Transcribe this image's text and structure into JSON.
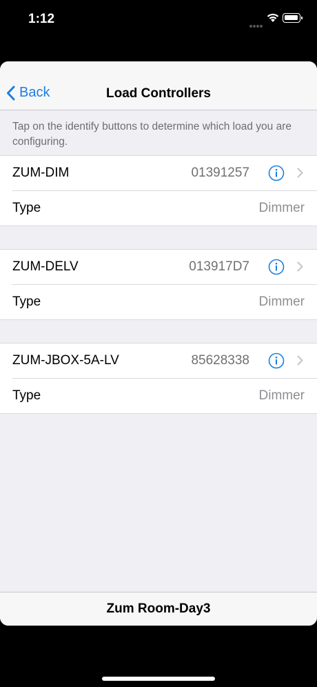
{
  "status_bar": {
    "time": "1:12"
  },
  "nav": {
    "back_label": "Back",
    "title": "Load Controllers"
  },
  "instructions": "Tap on the identify buttons to determine which load you are configuring.",
  "controllers": [
    {
      "name": "ZUM-DIM",
      "serial": "01391257",
      "type_label": "Type",
      "type_value": "Dimmer"
    },
    {
      "name": "ZUM-DELV",
      "serial": "013917D7",
      "type_label": "Type",
      "type_value": "Dimmer"
    },
    {
      "name": "ZUM-JBOX-5A-LV",
      "serial": "85628338",
      "type_label": "Type",
      "type_value": "Dimmer"
    }
  ],
  "footer": {
    "room_name": "Zum Room-Day3"
  },
  "colors": {
    "accent": "#1b7fe0",
    "background": "#efeff4"
  },
  "icons": [
    "wifi-icon",
    "battery-icon",
    "back-chevron-icon",
    "info-icon",
    "chevron-right-icon"
  ]
}
